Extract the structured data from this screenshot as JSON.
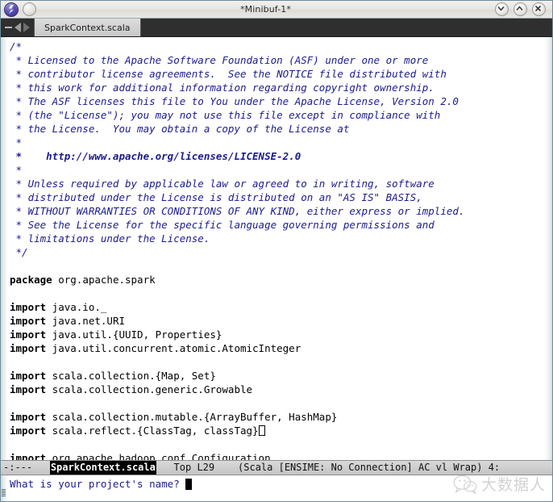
{
  "window": {
    "title": "*Minibuf-1*",
    "app_icon": "emacs-icon",
    "controls": {
      "minimize_label": "▾",
      "maximize_label": "▴",
      "close_label": "✕"
    }
  },
  "tabbar": {
    "dash_label": "—",
    "prev_label": "◀",
    "next_label": "▶",
    "tabs": [
      {
        "label": "SparkContext.scala",
        "active": true
      }
    ]
  },
  "buffer": {
    "lines": [
      {
        "text": "/*",
        "style": "comment"
      },
      {
        "text": " * Licensed to the Apache Software Foundation (ASF) under one or more",
        "style": "comment"
      },
      {
        "text": " * contributor license agreements.  See the NOTICE file distributed with",
        "style": "comment"
      },
      {
        "text": " * this work for additional information regarding copyright ownership.",
        "style": "comment"
      },
      {
        "text": " * The ASF licenses this file to You under the Apache License, Version 2.0",
        "style": "comment"
      },
      {
        "text": " * (the \"License\"); you may not use this file except in compliance with",
        "style": "comment"
      },
      {
        "text": " * the License.  You may obtain a copy of the License at",
        "style": "comment"
      },
      {
        "text": " *",
        "style": "comment"
      },
      {
        "text": " *    http://www.apache.org/licenses/LICENSE-2.0",
        "style": "comment-bold"
      },
      {
        "text": " *",
        "style": "comment"
      },
      {
        "text": " * Unless required by applicable law or agreed to in writing, software",
        "style": "comment"
      },
      {
        "text": " * distributed under the License is distributed on an \"AS IS\" BASIS,",
        "style": "comment"
      },
      {
        "text": " * WITHOUT WARRANTIES OR CONDITIONS OF ANY KIND, either express or implied.",
        "style": "comment"
      },
      {
        "text": " * See the License for the specific language governing permissions and",
        "style": "comment"
      },
      {
        "text": " * limitations under the License.",
        "style": "comment"
      },
      {
        "text": " */",
        "style": "comment"
      },
      {
        "text": "",
        "style": "plain"
      },
      {
        "keyword": "package",
        "text": " org.apache.spark",
        "style": "code"
      },
      {
        "text": "",
        "style": "plain"
      },
      {
        "keyword": "import",
        "text": " java.io._",
        "style": "code"
      },
      {
        "keyword": "import",
        "text": " java.net.URI",
        "style": "code"
      },
      {
        "keyword": "import",
        "text": " java.util.{UUID, Properties}",
        "style": "code"
      },
      {
        "keyword": "import",
        "text": " java.util.concurrent.atomic.AtomicInteger",
        "style": "code"
      },
      {
        "text": "",
        "style": "plain"
      },
      {
        "keyword": "import",
        "text": " scala.collection.{Map, Set}",
        "style": "code"
      },
      {
        "keyword": "import",
        "text": " scala.collection.generic.Growable",
        "style": "code"
      },
      {
        "text": "",
        "style": "plain"
      },
      {
        "keyword": "import",
        "text": " scala.collection.mutable.{ArrayBuffer, HashMap}",
        "style": "code"
      },
      {
        "keyword": "import",
        "text": " scala.reflect.{ClassTag, classTag}",
        "style": "code",
        "cursor": true
      },
      {
        "text": "",
        "style": "plain"
      },
      {
        "keyword": "import",
        "text": " org.apache.hadoop.conf.Configuration",
        "style": "code"
      }
    ]
  },
  "modeline": {
    "flags": "-:---",
    "buffer_name": "SparkContext.scala",
    "position": "Top L29",
    "modes": "(Scala [ENSIME: No Connection] AC vl Wrap)",
    "tail": "4:"
  },
  "minibuffer": {
    "prompt": "What is your project's name?",
    "value": ""
  },
  "watermark": {
    "text": "大数据人",
    "icon": "wechat-icon"
  }
}
